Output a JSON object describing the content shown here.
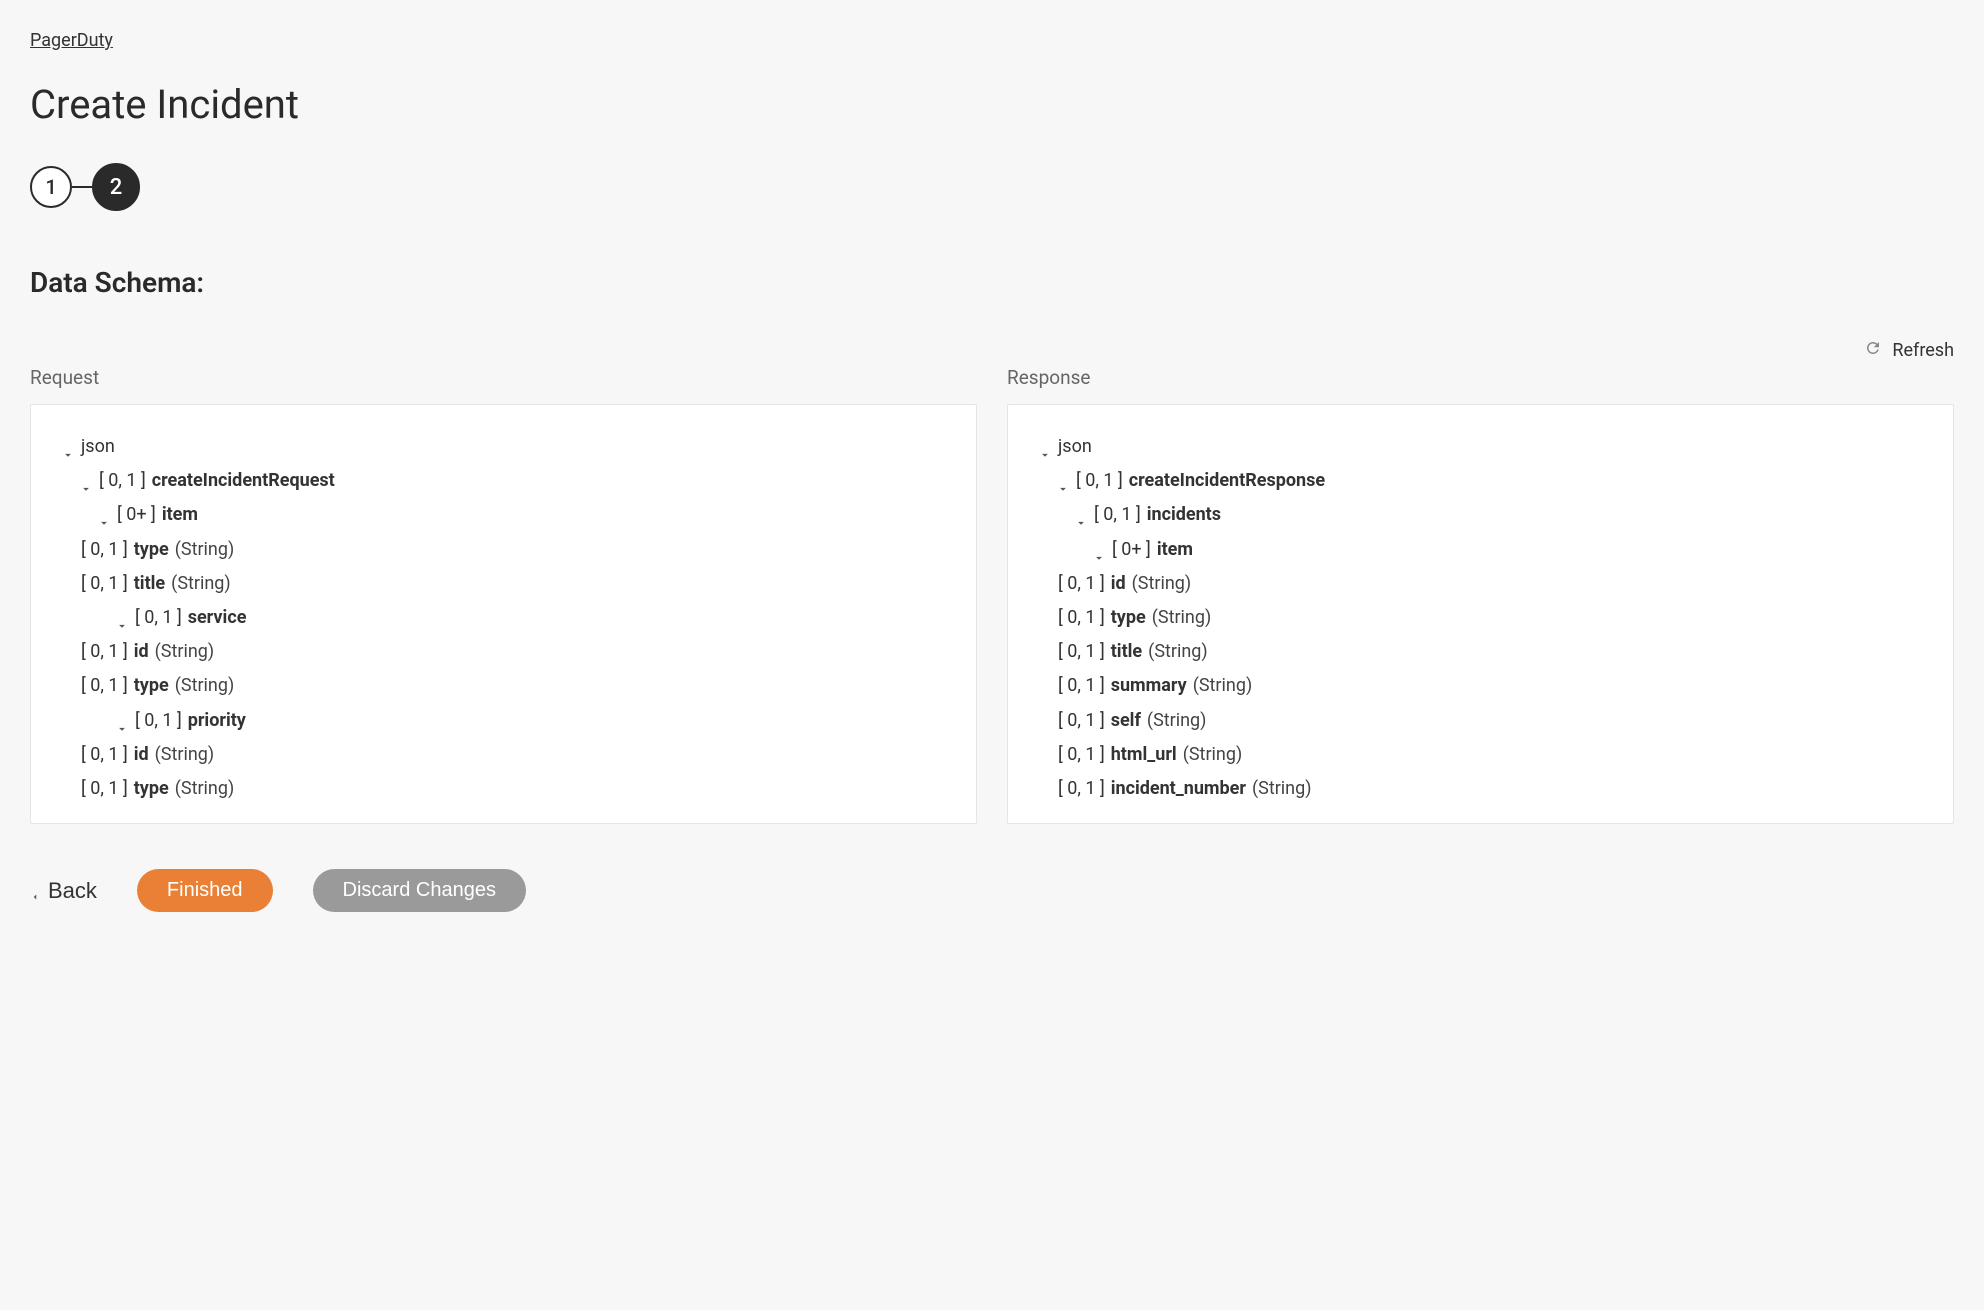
{
  "breadcrumb": "PagerDuty",
  "pageTitle": "Create Incident",
  "stepper": {
    "step1": "1",
    "step2": "2"
  },
  "sectionTitle": "Data Schema:",
  "refresh": "Refresh",
  "request": {
    "header": "Request",
    "root": "json",
    "nodes": {
      "create": {
        "range": "[ 0, 1 ]",
        "name": "createIncidentRequest"
      },
      "item": {
        "range": "[ 0+ ]",
        "name": "item"
      },
      "type": {
        "range": "[ 0, 1 ]",
        "name": "type",
        "dtype": "(String)"
      },
      "title": {
        "range": "[ 0, 1 ]",
        "name": "title",
        "dtype": "(String)"
      },
      "service": {
        "range": "[ 0, 1 ]",
        "name": "service"
      },
      "svcId": {
        "range": "[ 0, 1 ]",
        "name": "id",
        "dtype": "(String)"
      },
      "svcType": {
        "range": "[ 0, 1 ]",
        "name": "type",
        "dtype": "(String)"
      },
      "priority": {
        "range": "[ 0, 1 ]",
        "name": "priority"
      },
      "prId": {
        "range": "[ 0, 1 ]",
        "name": "id",
        "dtype": "(String)"
      },
      "prType": {
        "range": "[ 0, 1 ]",
        "name": "type",
        "dtype": "(String)"
      }
    }
  },
  "response": {
    "header": "Response",
    "root": "json",
    "nodes": {
      "create": {
        "range": "[ 0, 1 ]",
        "name": "createIncidentResponse"
      },
      "incidents": {
        "range": "[ 0, 1 ]",
        "name": "incidents"
      },
      "item": {
        "range": "[ 0+ ]",
        "name": "item"
      },
      "id": {
        "range": "[ 0, 1 ]",
        "name": "id",
        "dtype": "(String)"
      },
      "type": {
        "range": "[ 0, 1 ]",
        "name": "type",
        "dtype": "(String)"
      },
      "title": {
        "range": "[ 0, 1 ]",
        "name": "title",
        "dtype": "(String)"
      },
      "summary": {
        "range": "[ 0, 1 ]",
        "name": "summary",
        "dtype": "(String)"
      },
      "self": {
        "range": "[ 0, 1 ]",
        "name": "self",
        "dtype": "(String)"
      },
      "htmlUrl": {
        "range": "[ 0, 1 ]",
        "name": "html_url",
        "dtype": "(String)"
      },
      "incNum": {
        "range": "[ 0, 1 ]",
        "name": "incident_number",
        "dtype": "(String)"
      }
    }
  },
  "footer": {
    "back": "Back",
    "finished": "Finished",
    "discard": "Discard Changes"
  }
}
